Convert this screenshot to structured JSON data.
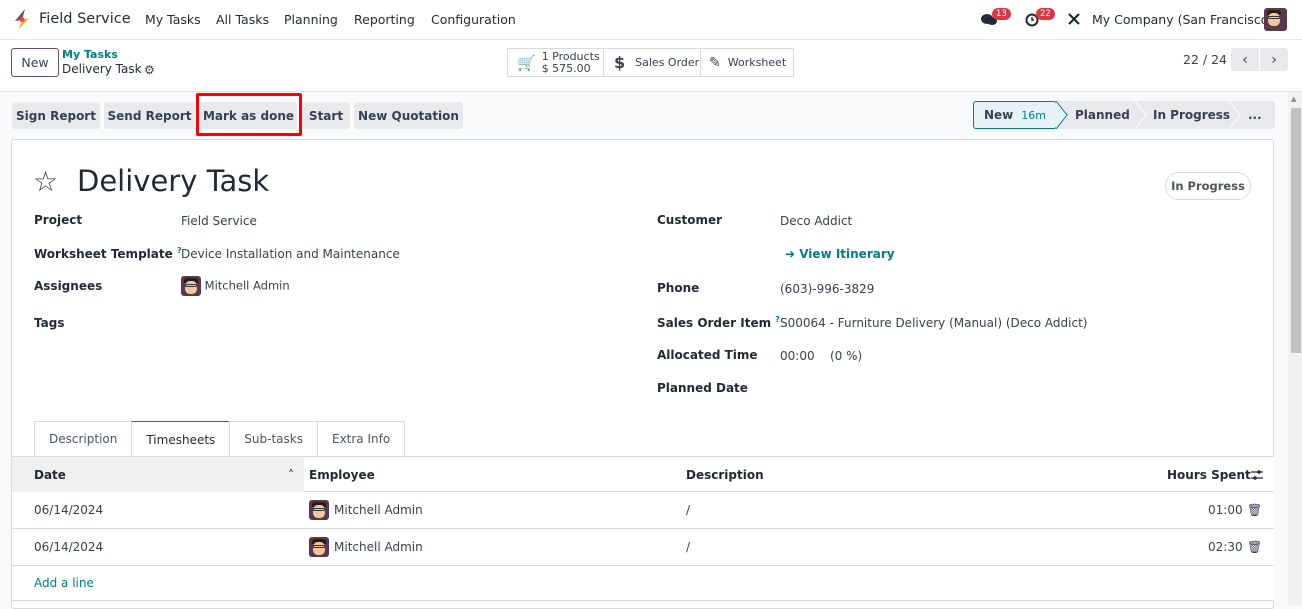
{
  "topbar": {
    "app_name": "Field Service",
    "menu": [
      "My Tasks",
      "All Tasks",
      "Planning",
      "Reporting",
      "Configuration"
    ],
    "messages_count": "13",
    "activities_count": "22",
    "company": "My Company (San Francisco)"
  },
  "control_panel": {
    "new_label": "New",
    "breadcrumb_parent": "My Tasks",
    "breadcrumb_current": "Delivery Task",
    "smart_buttons": {
      "products_count": "1 Products",
      "products_amount": "$ 575.00",
      "sales_order": "Sales Order",
      "worksheet": "Worksheet"
    },
    "pager": "22 / 24"
  },
  "actions": [
    "Sign Report",
    "Send Report",
    "Mark as done",
    "Start",
    "New Quotation"
  ],
  "highlighted_action": "Mark as done",
  "statusbar": {
    "stages": [
      "New",
      "Planned",
      "In Progress",
      "..."
    ],
    "current": "New",
    "current_duration": "16m"
  },
  "form": {
    "title": "Delivery Task",
    "state": "In Progress",
    "left_fields": [
      {
        "label": "Project",
        "value": "Field Service"
      },
      {
        "label": "Worksheet Template",
        "value": "Device Installation and Maintenance",
        "help": "?"
      },
      {
        "label": "Assignees",
        "value": "Mitchell Admin"
      },
      {
        "label": "Tags",
        "value": ""
      }
    ],
    "right_fields": {
      "customer_label": "Customer",
      "customer": "Deco Addict",
      "itinerary_link": "View Itinerary",
      "phone_label": "Phone",
      "phone": "(603)-996-3829",
      "sol_label": "Sales Order Item",
      "sol_help": "?",
      "sol": "S00064 - Furniture Delivery (Manual) (Deco Addict)",
      "allocated_label": "Allocated Time",
      "allocated": "00:00",
      "allocated_pct": "(0 %)",
      "planned_label": "Planned Date",
      "planned": ""
    }
  },
  "tabs": [
    "Description",
    "Timesheets",
    "Sub-tasks",
    "Extra Info"
  ],
  "active_tab": "Timesheets",
  "timesheets": {
    "columns": [
      "Date",
      "Employee",
      "Description",
      "Hours Spent"
    ],
    "rows": [
      {
        "date": "06/14/2024",
        "employee": "Mitchell Admin",
        "description": "/",
        "hours": "01:00"
      },
      {
        "date": "06/14/2024",
        "employee": "Mitchell Admin",
        "description": "/",
        "hours": "02:30"
      }
    ],
    "add_line": "Add a line"
  },
  "colors": {
    "brand": "#714B67",
    "link": "#017e84",
    "badge": "#dc3545",
    "highlight": "#ff0000"
  }
}
